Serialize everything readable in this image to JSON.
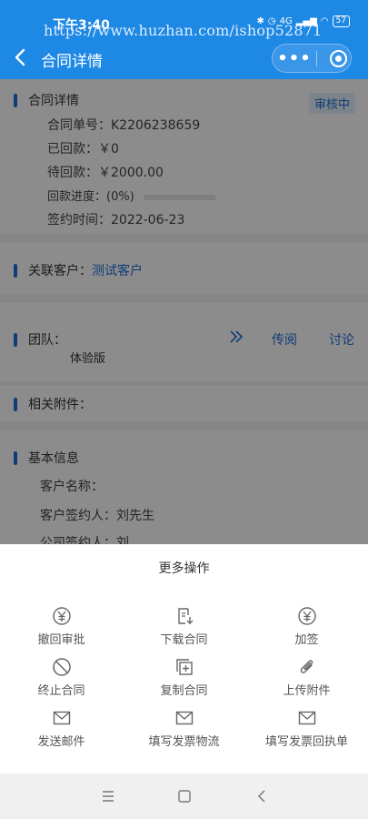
{
  "status_bar": {
    "time": "下午3:40",
    "watermark": "https://www.huzhan.com/ishop52871",
    "network": "4G",
    "battery": "57"
  },
  "nav": {
    "title": "合同详情",
    "more_icon": "more-dots-icon",
    "home_icon": "target-icon"
  },
  "contract": {
    "section_title": "合同详情",
    "status_badge": "审核中",
    "number_label": "合同单号：",
    "number": "K2206238659",
    "paid_label": "已回款：",
    "paid": "￥0",
    "pending_label": "待回款：",
    "pending": "￥2000.00",
    "progress_label": "回款进度：",
    "progress_text": "(0%)",
    "progress_value": 0,
    "sign_date_label": "签约时间：",
    "sign_date": "2022-06-23"
  },
  "customer": {
    "label": "关联客户：",
    "value": "测试客户"
  },
  "team": {
    "label": "团队：",
    "member": "体验版",
    "expand_icon": "double-chevron-right-icon",
    "circulate": "传阅",
    "discuss": "讨论"
  },
  "attachments": {
    "label": "相关附件："
  },
  "basic_info": {
    "section_title": "基本信息",
    "customer_name_label": "客户名称：",
    "customer_signer_label": "客户签约人：",
    "customer_signer": "刘先生",
    "company_signer_label": "公司签约人：",
    "company_signer": "刘"
  },
  "sheet": {
    "title": "更多操作",
    "ops": [
      {
        "label": "撤回审批",
        "icon": "yen-circle-icon"
      },
      {
        "label": "下载合同",
        "icon": "download-document-icon"
      },
      {
        "label": "加签",
        "icon": "yen-circle-icon"
      },
      {
        "label": "终止合同",
        "icon": "prohibited-icon"
      },
      {
        "label": "复制合同",
        "icon": "copy-add-icon"
      },
      {
        "label": "上传附件",
        "icon": "paperclip-icon"
      },
      {
        "label": "发送邮件",
        "icon": "mail-icon"
      },
      {
        "label": "填写发票物流",
        "icon": "mail-icon"
      },
      {
        "label": "填写发票回执单",
        "icon": "mail-icon"
      }
    ]
  },
  "system_nav": {
    "menu_icon": "menu-icon",
    "home_icon": "square-home-icon",
    "back_icon": "back-arrow-icon"
  },
  "colors": {
    "primary": "#1e88e5",
    "accent_text": "#1e6fd9",
    "overlay": "rgba(0,0,0,0.45)"
  }
}
